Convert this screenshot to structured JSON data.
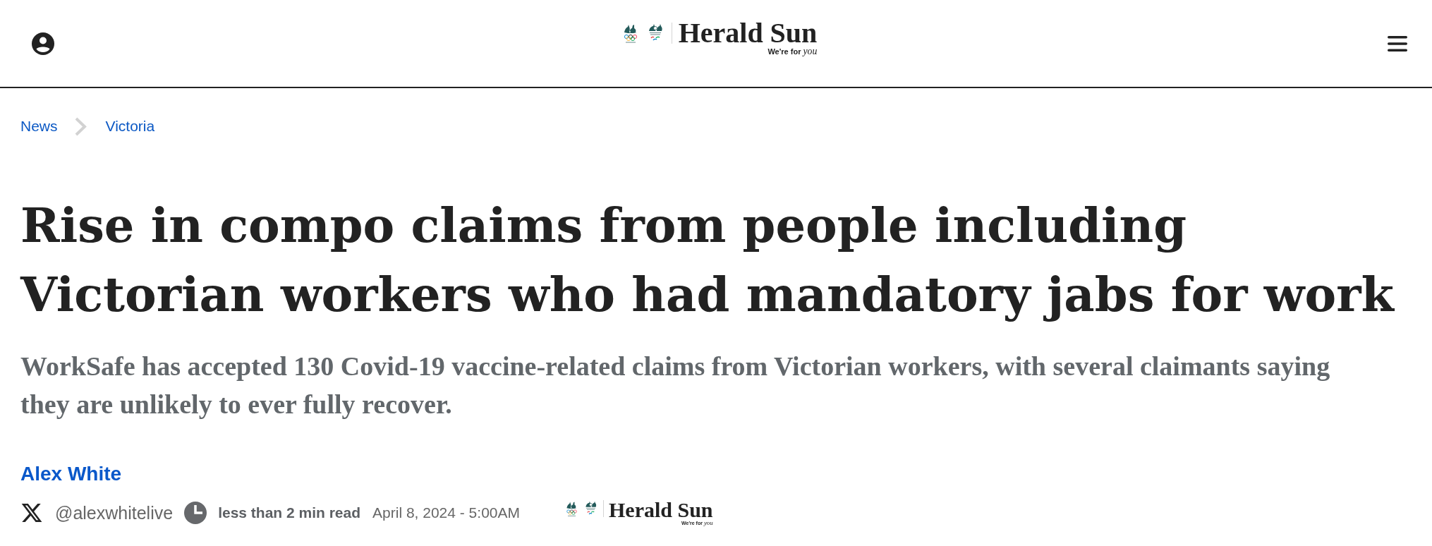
{
  "header": {
    "logo": {
      "wordmark": "Herald Sun",
      "tagline": "We're for *you*"
    }
  },
  "breadcrumb": [
    {
      "label": "News"
    },
    {
      "label": "Victoria"
    }
  ],
  "headline": "Rise in compo claims from people including Victorian workers who had mandatory jabs for work",
  "standfirst": "WorkSafe has accepted 130 Covid-19 vaccine-related claims from Victorian workers, with several claimants saying they are unlikely to ever fully recover.",
  "byline": {
    "author": "Alex White",
    "handle": "@alexwhitelive",
    "read_time": "less than 2 min read",
    "published": "April 8, 2024 - 5:00AM",
    "logo": {
      "wordmark": "Herald Sun",
      "tagline": "We're for *you*"
    }
  }
}
